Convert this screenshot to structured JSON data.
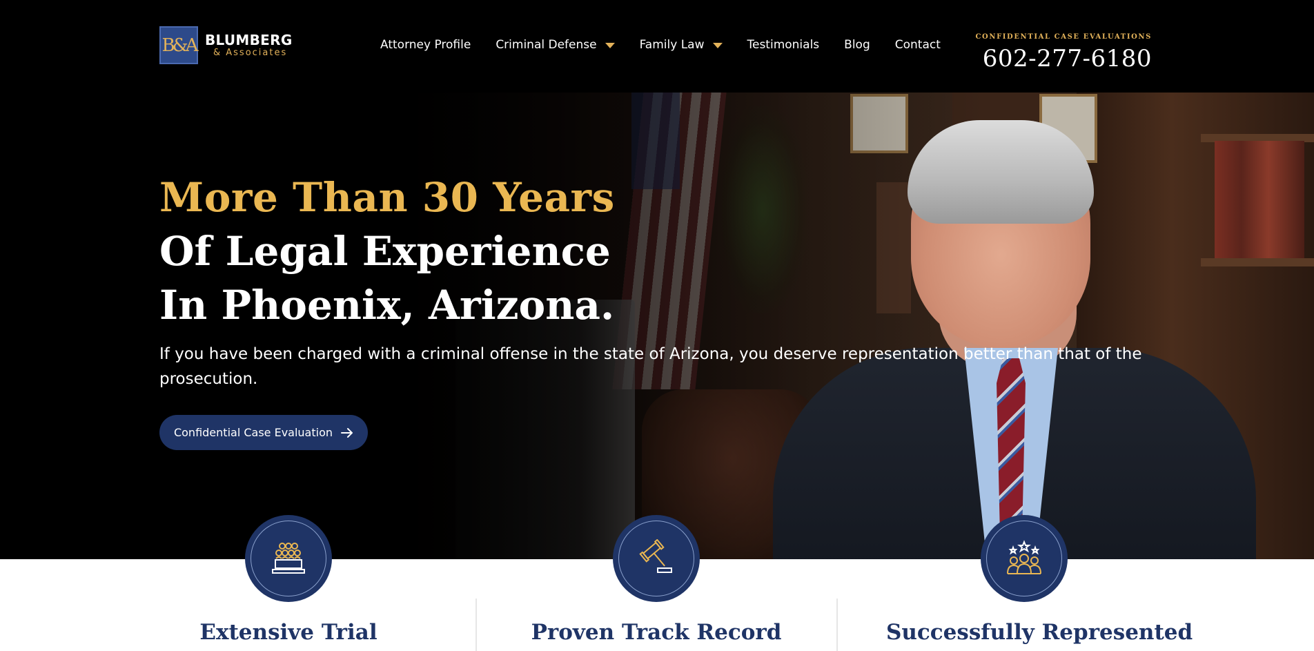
{
  "brand": {
    "logo_mark": "B&A",
    "name": "BLUMBERG",
    "sub": "& Associates"
  },
  "nav": {
    "items": [
      {
        "label": "Attorney Profile"
      },
      {
        "label": "Criminal Defense",
        "has_dropdown": true
      },
      {
        "label": "Family Law",
        "has_dropdown": true
      },
      {
        "label": "Testimonials"
      },
      {
        "label": "Blog"
      },
      {
        "label": "Contact"
      }
    ]
  },
  "contact": {
    "label": "CONFIDENTIAL CASE EVALUATIONS",
    "phone": "602-277-6180"
  },
  "hero": {
    "line1": "More Than 30 Years",
    "line2": "Of Legal Experience",
    "line3": "In Phoenix, Arizona.",
    "paragraph": "If you have been charged with a criminal offense in the state of Arizona, you deserve representation better than that of the prosecution.",
    "cta_label": "Confidential Case Evaluation"
  },
  "features": [
    {
      "title": "Extensive Trial",
      "icon": "jury-icon"
    },
    {
      "title": "Proven Track Record",
      "icon": "gavel-icon"
    },
    {
      "title": "Successfully Represented",
      "icon": "clients-stars-icon"
    }
  ],
  "colors": {
    "gold": "#eab752",
    "navy": "#1f3466",
    "black": "#000000",
    "white": "#ffffff"
  }
}
